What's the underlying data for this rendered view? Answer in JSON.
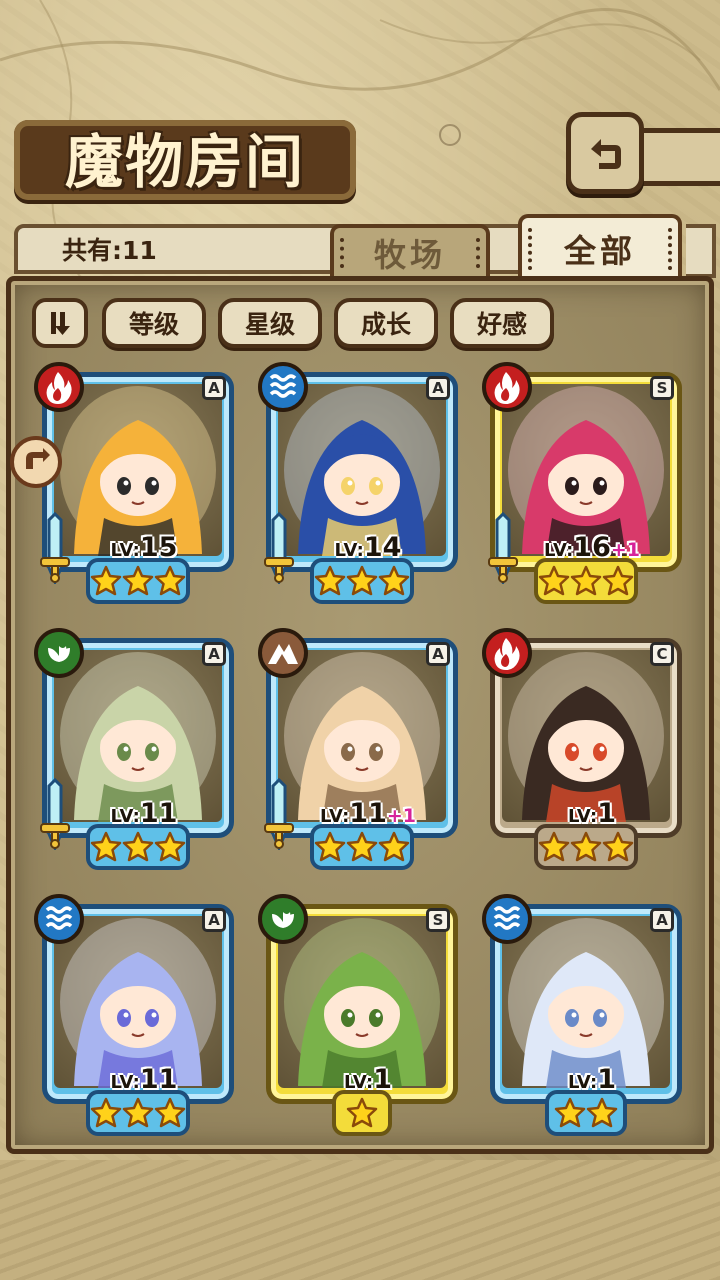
{
  "header": {
    "title": "魔物房间",
    "back_icon": "back-arrow-icon"
  },
  "count_label": "共有:11",
  "tabs": [
    {
      "label": "牧场",
      "active": false
    },
    {
      "label": "全部",
      "active": true
    }
  ],
  "sort": {
    "toggle_icon": "sort-order-icon",
    "buttons": [
      "等级",
      "星级",
      "成长",
      "好感"
    ]
  },
  "monsters": [
    {
      "rank": "A",
      "element": "fire",
      "level": "15",
      "bonus": "",
      "stars": 3,
      "frame": "blue",
      "weapon": true
    },
    {
      "rank": "A",
      "element": "water",
      "level": "14",
      "bonus": "",
      "stars": 3,
      "frame": "blue",
      "weapon": true
    },
    {
      "rank": "S",
      "element": "fire",
      "level": "16",
      "bonus": "+1",
      "stars": 3,
      "frame": "gold",
      "weapon": true
    },
    {
      "rank": "A",
      "element": "wood",
      "level": "11",
      "bonus": "",
      "stars": 3,
      "frame": "blue",
      "weapon": true
    },
    {
      "rank": "A",
      "element": "earth",
      "level": "11",
      "bonus": "+1",
      "stars": 3,
      "frame": "blue",
      "weapon": true
    },
    {
      "rank": "C",
      "element": "fire",
      "level": "1",
      "bonus": "",
      "stars": 3,
      "frame": "brown",
      "weapon": false
    },
    {
      "rank": "A",
      "element": "water",
      "level": "11",
      "bonus": "",
      "stars": 3,
      "frame": "blue",
      "weapon": false
    },
    {
      "rank": "S",
      "element": "wood",
      "level": "1",
      "bonus": "",
      "stars": 1,
      "frame": "gold",
      "weapon": false
    },
    {
      "rank": "A",
      "element": "water",
      "level": "1",
      "bonus": "",
      "stars": 2,
      "frame": "blue",
      "weapon": false
    }
  ],
  "level_prefix": "LV:",
  "colors": {
    "fire": "#c41f1f",
    "water": "#2278c4",
    "wood": "#2f7d2a",
    "earth": "#8a5a3a",
    "frame_blue": "#5fc0e8",
    "frame_gold": "#f3dc3a",
    "frame_brown": "#bba98a"
  }
}
